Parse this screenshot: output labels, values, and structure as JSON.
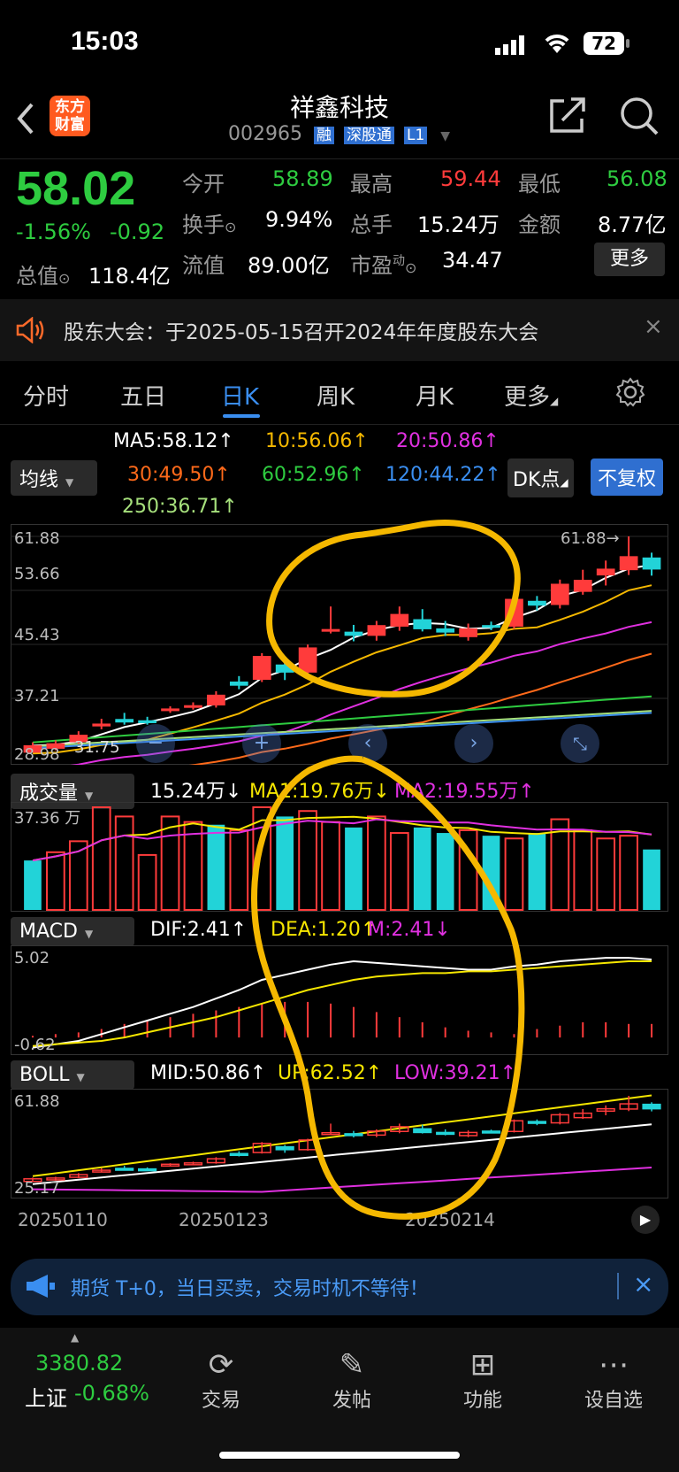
{
  "status": {
    "time": "15:03",
    "battery": "72"
  },
  "header": {
    "back_icon": "chevron-left-icon",
    "logo_text_1": "东方",
    "logo_text_2": "财富",
    "title": "祥鑫科技",
    "code": "002965",
    "badges": [
      "融",
      "深股通",
      "L1"
    ],
    "share_icon": "share-icon",
    "search_icon": "search-icon"
  },
  "quote": {
    "price": "58.02",
    "change_pct": "-1.56%",
    "change": "-0.92",
    "open_label": "今开",
    "open": "58.89",
    "high_label": "最高",
    "high": "59.44",
    "low_label": "最低",
    "low": "56.08",
    "turnover_label": "换手",
    "turnover": "9.94%",
    "volume_label": "总手",
    "volume": "15.24万",
    "amount_label": "金额",
    "amount": "8.77亿",
    "mcap_label": "总值",
    "mcap": "118.4亿",
    "float_label": "流值",
    "float": "89.00亿",
    "pe_label": "市盈",
    "pe_sup": "动",
    "pe": "34.47",
    "more": "更多"
  },
  "notice": {
    "text": "股东大会：于2025-05-15召开2024年年度股东大会"
  },
  "tabs": [
    "分时",
    "五日",
    "日K",
    "周K",
    "月K",
    "更多"
  ],
  "active_tab": 2,
  "ma": {
    "selector": "均线",
    "ma5": "MA5:58.12↑",
    "ma10": "10:56.06↑",
    "ma20": "20:50.86↑",
    "ma30": "30:49.50↑",
    "ma60": "60:52.96↑",
    "ma120": "120:44.22↑",
    "ma250": "250:36.71↑",
    "dk": "DK点",
    "fuquan": "不复权"
  },
  "kline_axis": [
    "61.88",
    "53.66",
    "45.43",
    "37.21",
    "28.98"
  ],
  "kline_max_label": "61.88→",
  "kline_min_label": "31.75",
  "volume": {
    "selector": "成交量",
    "vol": "15.24万↓",
    "ma1": "MA1:19.76万↓",
    "ma2": "MA2:19.55万↑",
    "axis_top": "37.36 万"
  },
  "macd": {
    "selector": "MACD",
    "dif": "DIF:2.41↑",
    "dea": "DEA:1.20↑",
    "m": "M:2.41↓",
    "axis_top": "5.02",
    "axis_bottom": "-0.62"
  },
  "boll": {
    "selector": "BOLL",
    "mid": "MID:50.86↑",
    "up": "UP:62.52↑",
    "low": "LOW:39.21↑",
    "axis_top": "61.88",
    "axis_bottom": "25.17"
  },
  "dates": [
    "20250110",
    "20250123",
    "20250214"
  ],
  "ad": {
    "text": "期货 T+0，当日买卖，交易时机不等待！"
  },
  "bottom": {
    "index_value": "3380.82",
    "index_name": "上证",
    "index_change": "-0.68%",
    "tools": [
      {
        "label": "交易",
        "icon": "trade-icon"
      },
      {
        "label": "发帖",
        "icon": "post-icon"
      },
      {
        "label": "功能",
        "icon": "apps-icon"
      },
      {
        "label": "设自选",
        "icon": "more-icon"
      }
    ]
  },
  "colors": {
    "up": "#ff3b3b",
    "down": "#2ecc40",
    "cyan": "#22d3d8",
    "accent": "#3a7bd5",
    "circle": "#f5b800"
  },
  "chart_data": {
    "type": "candlestick",
    "candles": [
      {
        "o": 29.0,
        "c": 30.0,
        "h": 30.5,
        "l": 28.98,
        "up": true
      },
      {
        "o": 29.6,
        "c": 30.3,
        "h": 30.8,
        "l": 29.3,
        "up": true
      },
      {
        "o": 30.6,
        "c": 31.6,
        "h": 32.2,
        "l": 30.3,
        "up": true
      },
      {
        "o": 33.0,
        "c": 33.3,
        "h": 34.1,
        "l": 32.5,
        "up": true
      },
      {
        "o": 34.0,
        "c": 33.6,
        "h": 35.0,
        "l": 33.2,
        "up": false
      },
      {
        "o": 33.5,
        "c": 33.8,
        "h": 34.4,
        "l": 33.2,
        "up": false
      },
      {
        "o": 35.4,
        "c": 35.6,
        "h": 36.0,
        "l": 35.0,
        "up": true
      },
      {
        "o": 35.9,
        "c": 36.1,
        "h": 36.6,
        "l": 35.5,
        "up": true
      },
      {
        "o": 36.2,
        "c": 37.7,
        "h": 38.3,
        "l": 35.8,
        "up": true
      },
      {
        "o": 39.2,
        "c": 39.7,
        "h": 40.6,
        "l": 38.6,
        "up": false
      },
      {
        "o": 40.1,
        "c": 43.6,
        "h": 44.1,
        "l": 39.7,
        "up": true
      },
      {
        "o": 42.3,
        "c": 41.2,
        "h": 43.0,
        "l": 40.0,
        "up": false
      },
      {
        "o": 41.2,
        "c": 44.9,
        "h": 45.4,
        "l": 40.8,
        "up": true
      },
      {
        "o": 47.5,
        "c": 47.7,
        "h": 51.2,
        "l": 47.1,
        "up": true
      },
      {
        "o": 47.3,
        "c": 46.8,
        "h": 48.4,
        "l": 45.9,
        "up": false
      },
      {
        "o": 46.8,
        "c": 48.3,
        "h": 49.0,
        "l": 46.0,
        "up": true
      },
      {
        "o": 48.2,
        "c": 50.0,
        "h": 51.2,
        "l": 47.5,
        "up": true
      },
      {
        "o": 49.2,
        "c": 47.8,
        "h": 50.8,
        "l": 47.4,
        "up": false
      },
      {
        "o": 47.3,
        "c": 47.8,
        "h": 49.0,
        "l": 46.7,
        "up": false
      },
      {
        "o": 46.6,
        "c": 47.8,
        "h": 48.6,
        "l": 46.0,
        "up": true
      },
      {
        "o": 48.2,
        "c": 48.3,
        "h": 48.9,
        "l": 47.6,
        "up": false
      },
      {
        "o": 48.2,
        "c": 52.3,
        "h": 52.8,
        "l": 47.8,
        "up": true
      },
      {
        "o": 52.0,
        "c": 51.4,
        "h": 52.8,
        "l": 50.6,
        "up": false
      },
      {
        "o": 51.5,
        "c": 54.6,
        "h": 55.3,
        "l": 50.9,
        "up": true
      },
      {
        "o": 53.5,
        "c": 55.2,
        "h": 56.8,
        "l": 53.0,
        "up": true
      },
      {
        "o": 56.0,
        "c": 56.9,
        "h": 58.2,
        "l": 54.4,
        "up": true
      },
      {
        "o": 56.8,
        "c": 58.8,
        "h": 61.88,
        "l": 56.0,
        "up": true
      },
      {
        "o": 58.6,
        "c": 56.9,
        "h": 59.4,
        "l": 55.9,
        "up": false
      }
    ],
    "volumes": [
      18,
      21,
      25,
      37.36,
      34,
      20,
      34,
      32,
      31,
      29,
      37.36,
      34,
      36,
      32,
      30,
      34,
      28,
      30,
      28,
      29,
      27,
      26,
      28,
      33,
      29,
      26,
      27,
      22
    ],
    "volume_up": [
      false,
      true,
      true,
      true,
      true,
      true,
      true,
      true,
      false,
      true,
      true,
      false,
      true,
      true,
      false,
      true,
      true,
      false,
      false,
      true,
      false,
      true,
      false,
      true,
      true,
      true,
      true,
      false
    ],
    "macd_hist": [
      0.1,
      0.2,
      0.3,
      0.5,
      0.8,
      1.0,
      1.2,
      1.4,
      1.6,
      1.8,
      2.0,
      2.1,
      2.1,
      2.0,
      1.8,
      1.5,
      1.2,
      0.9,
      0.6,
      0.4,
      0.3,
      0.2,
      0.5,
      0.7,
      0.9,
      0.9,
      0.8,
      0.8
    ],
    "dif": [
      -0.6,
      -0.4,
      -0.2,
      0.2,
      0.6,
      1.0,
      1.4,
      1.8,
      2.3,
      2.8,
      3.4,
      3.7,
      4.0,
      4.3,
      4.5,
      4.4,
      4.3,
      4.2,
      4.1,
      4.0,
      4.0,
      4.2,
      4.3,
      4.5,
      4.6,
      4.7,
      4.7,
      4.6
    ],
    "dea": [
      -0.5,
      -0.4,
      -0.3,
      -0.2,
      0.0,
      0.3,
      0.6,
      0.9,
      1.2,
      1.6,
      2.0,
      2.4,
      2.8,
      3.1,
      3.4,
      3.6,
      3.7,
      3.8,
      3.8,
      3.9,
      3.9,
      4.0,
      4.1,
      4.2,
      4.3,
      4.4,
      4.5,
      4.5
    ]
  }
}
